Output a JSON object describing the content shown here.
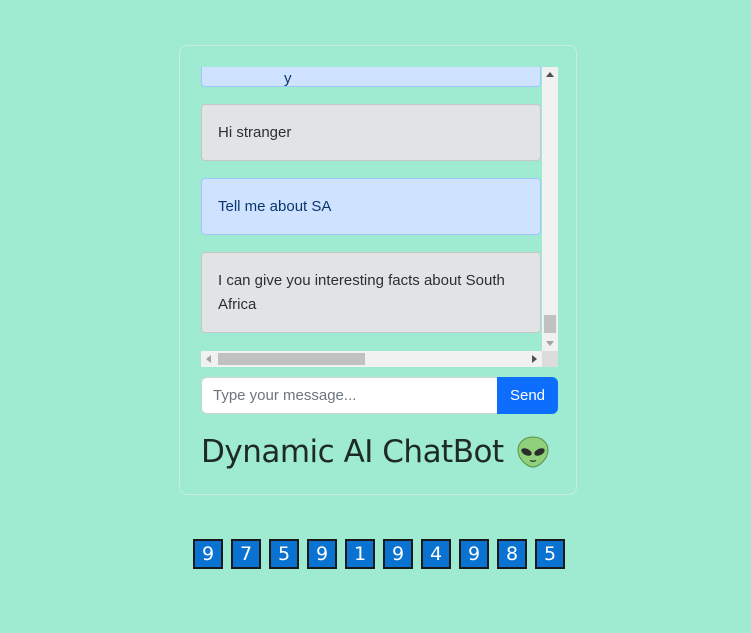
{
  "chat": {
    "partial_message": "...y",
    "messages": [
      {
        "role": "bot",
        "text": "Hi stranger"
      },
      {
        "role": "user",
        "text": "Tell me about SA"
      },
      {
        "role": "bot",
        "text": "I can give you interesting facts about South Africa"
      }
    ]
  },
  "input": {
    "placeholder": "Type your message...",
    "send_label": "Send"
  },
  "title": {
    "text": "Dynamic AI ChatBot",
    "icon": "alien-icon"
  },
  "digits": [
    "9",
    "7",
    "5",
    "9",
    "1",
    "9",
    "4",
    "9",
    "8",
    "5"
  ],
  "colors": {
    "background": "#9eebd1",
    "user_bubble": "#cfe2ff",
    "bot_bubble": "#e2e3e5",
    "send_button": "#0d6efd",
    "digit_box": "#0a73d1"
  }
}
